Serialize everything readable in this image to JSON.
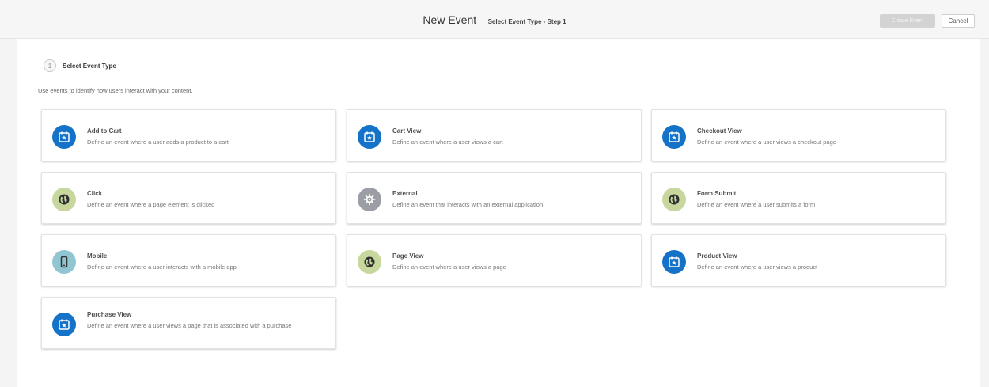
{
  "header": {
    "title": "New Event",
    "subtitle": "Select Event Type - Step 1",
    "create_label": "Create Event",
    "cancel_label": "Cancel"
  },
  "step": {
    "number": "1",
    "label": "Select Event Type"
  },
  "intro": "Use events to identify how users interact with your content.",
  "cards": [
    {
      "title": "Add to Cart",
      "desc": "Define an event where a user adds a product to a cart",
      "icon": "calendar-star-icon"
    },
    {
      "title": "Cart View",
      "desc": "Define an event where a user views a cart",
      "icon": "calendar-star-icon"
    },
    {
      "title": "Checkout View",
      "desc": "Define an event where a user views a checkout page",
      "icon": "calendar-star-icon"
    },
    {
      "title": "Click",
      "desc": "Define an event where a page element is clicked",
      "icon": "globe-icon"
    },
    {
      "title": "External",
      "desc": "Define an event that interacts with an external application",
      "icon": "gear-icon"
    },
    {
      "title": "Form Submit",
      "desc": "Define an event where a user submits a form",
      "icon": "globe-icon"
    },
    {
      "title": "Mobile",
      "desc": "Define an event where a user interacts with a mobile app",
      "icon": "mobile-phone-icon"
    },
    {
      "title": "Page View",
      "desc": "Define an event where a user views a page",
      "icon": "globe-icon"
    },
    {
      "title": "Product View",
      "desc": "Define an event where a user views a product",
      "icon": "calendar-star-icon"
    },
    {
      "title": "Purchase View",
      "desc": "Define an event where a user views a page that is associated with a purchase",
      "icon": "calendar-star-icon"
    }
  ],
  "colors": {
    "accent_blue": "#1473c8",
    "globe_green": "#c7d79e",
    "gear_gray": "#9b9ea4",
    "mobile_teal": "#8fc6d1"
  }
}
